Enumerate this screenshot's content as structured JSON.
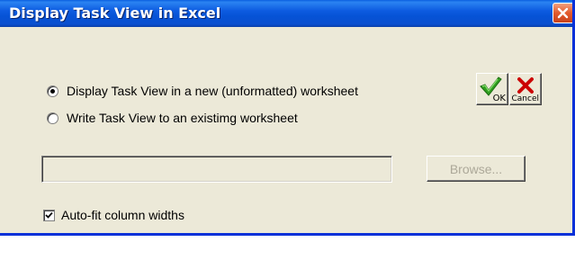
{
  "window": {
    "title": "Display Task View in Excel"
  },
  "options": {
    "new_worksheet": {
      "label": "Display Task View in a new (unformatted) worksheet",
      "selected": true
    },
    "existing_worksheet": {
      "label": "Write Task View to an existimg worksheet",
      "selected": false
    }
  },
  "worksheet_path": {
    "value": "",
    "enabled": false
  },
  "browse": {
    "label": "Browse...",
    "enabled": false
  },
  "autofit": {
    "label": "Auto-fit column widths",
    "checked": true
  },
  "buttons": {
    "ok": {
      "label": "OK",
      "icon": "green-checkmark-icon"
    },
    "cancel": {
      "label": "Cancel",
      "icon": "red-x-icon"
    }
  },
  "colors": {
    "titlebar": "#0a5fe0",
    "dialog_bg": "#ece9d8",
    "close_button": "#e35a2c",
    "ok_check": "#2f9e1f",
    "cancel_x": "#cc0000",
    "disabled_text": "#aca899"
  }
}
